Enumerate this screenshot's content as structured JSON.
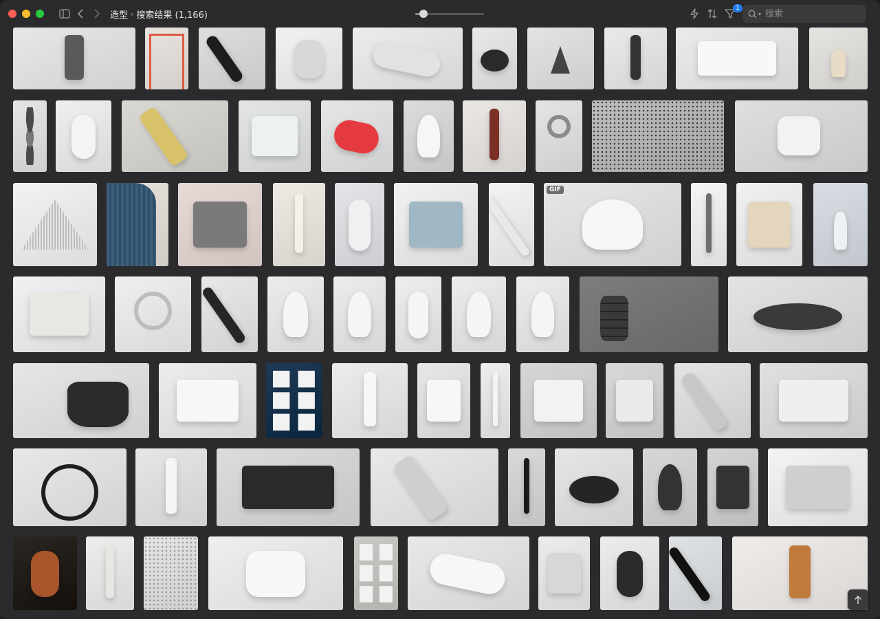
{
  "window": {
    "breadcrumb_parent": "造型",
    "breadcrumb_current": "搜索结果 (1,166)"
  },
  "toolbar": {
    "filter_badge": "1",
    "search_placeholder": "搜索",
    "zoom_level": 0.12
  },
  "icons": [
    "sidebar-icon",
    "back-icon",
    "forward-icon",
    "bolt-icon",
    "sort-icon",
    "filter-icon",
    "search-icon",
    "arrow-up-icon"
  ],
  "thumbnails": [
    {
      "bg": "#e7e7e7",
      "shape": "tall",
      "obj": "#5a5a5a"
    },
    {
      "bg": "#e9e4df",
      "shape": "shelf",
      "obj": "#e05a43"
    },
    {
      "bg": "#dedede",
      "shape": "diag",
      "obj": "#1d1d1f"
    },
    {
      "bg": "#f2f2f2",
      "shape": "round",
      "obj": "#d8d8d8"
    },
    {
      "bg": "#ececec",
      "shape": "pill",
      "obj": "#e2e2e2"
    },
    {
      "bg": "#e8e8e8",
      "shape": "disk",
      "obj": "#2a2a2a"
    },
    {
      "bg": "#e3e3e3",
      "shape": "cone",
      "obj": "#444"
    },
    {
      "bg": "#eaeaea",
      "shape": "tall",
      "obj": "#333"
    },
    {
      "bg": "#ebebeb",
      "shape": "box",
      "obj": "#f8f8f8"
    },
    {
      "bg": "#e6e4e1",
      "shape": "vase",
      "obj": "#e9dcc6"
    },
    {
      "bg": "#e5e5e5",
      "shape": "stones",
      "obj": "#4a4a4a"
    },
    {
      "bg": "#efefef",
      "shape": "round",
      "obj": "#f4f4f4"
    },
    {
      "bg": "#d9d8d3",
      "shape": "diag",
      "obj": "#d9c36a"
    },
    {
      "bg": "#e4e6e6",
      "shape": "box",
      "obj": "#eef1f1"
    },
    {
      "bg": "#e6e6e6",
      "shape": "pill",
      "obj": "#e53a40"
    },
    {
      "bg": "#dcdcdc",
      "shape": "dome",
      "obj": "#f6f6f6"
    },
    {
      "bg": "#ebe7e4",
      "shape": "tall",
      "obj": "#7a3024"
    },
    {
      "bg": "#e4e4e4",
      "shape": "ring",
      "obj": "#8a8a8a"
    },
    {
      "bg": "#bdbdbd",
      "shape": "dots",
      "obj": "#222"
    },
    {
      "bg": "#dfdfdf",
      "shape": "cube",
      "obj": "#f2f2f2"
    },
    {
      "bg": "#f2f2f2",
      "shape": "tent",
      "obj": "#bdbdbd"
    },
    {
      "bg": "#e8e2dc",
      "shape": "barrel",
      "obj": "#3c5f7d"
    },
    {
      "bg": "#e7dad6",
      "shape": "box",
      "obj": "#7a7a7a"
    },
    {
      "bg": "#eee9e3",
      "shape": "tall",
      "obj": "#f4f0ea"
    },
    {
      "bg": "#e2e4e8",
      "shape": "round",
      "obj": "#f0f0f0"
    },
    {
      "bg": "#f1f1f1",
      "shape": "box",
      "obj": "#9fb8c4"
    },
    {
      "bg": "#f3f3f3",
      "shape": "diag",
      "obj": "#e9e9e9"
    },
    {
      "bg": "#e7e6e7",
      "shape": "dome",
      "obj": "#f6f6f6",
      "gif": "GIF"
    },
    {
      "bg": "#f4f4f4",
      "shape": "tall",
      "obj": "#6e6e6e"
    },
    {
      "bg": "#f1f1f1",
      "shape": "box",
      "obj": "#e3d6bd"
    },
    {
      "bg": "#d8dde3",
      "shape": "vase",
      "obj": "#eef0f2"
    },
    {
      "bg": "#f1f1f1",
      "shape": "box",
      "obj": "#e8e8e3"
    },
    {
      "bg": "#efefef",
      "shape": "ring",
      "obj": "#bdbdbd"
    },
    {
      "bg": "#e8e8e8",
      "shape": "diag",
      "obj": "#262626"
    },
    {
      "bg": "#ececec",
      "shape": "dome",
      "obj": "#f5f5f5"
    },
    {
      "bg": "#ececec",
      "shape": "dome",
      "obj": "#f5f5f5"
    },
    {
      "bg": "#eeeeee",
      "shape": "round",
      "obj": "#f5f5f5"
    },
    {
      "bg": "#ececec",
      "shape": "dome",
      "obj": "#f5f5f5"
    },
    {
      "bg": "#ececec",
      "shape": "dome",
      "obj": "#f5f5f5"
    },
    {
      "bg": "#7d7d7d",
      "shape": "stack",
      "obj": "#3a3a3a"
    },
    {
      "bg": "#e3e3e3",
      "shape": "disk",
      "obj": "#3a3a3a"
    },
    {
      "bg": "#e6e6e6",
      "shape": "pot",
      "obj": "#2b2b2b"
    },
    {
      "bg": "#ececec",
      "shape": "box",
      "obj": "#f7f7f7"
    },
    {
      "bg": "#1f3a55",
      "shape": "grid",
      "obj": "#f2f2f2"
    },
    {
      "bg": "#ececec",
      "shape": "tall",
      "obj": "#f7f7f7"
    },
    {
      "bg": "#e7e7e7",
      "shape": "box",
      "obj": "#f7f7f7"
    },
    {
      "bg": "#ededed",
      "shape": "tall",
      "obj": "#f4f4f4"
    },
    {
      "bg": "#d7d7d7",
      "shape": "box",
      "obj": "#f2f2f2"
    },
    {
      "bg": "#d8d8d8",
      "shape": "box",
      "obj": "#eaeaea"
    },
    {
      "bg": "#e3e3e3",
      "shape": "diag",
      "obj": "#c8c8c8"
    },
    {
      "bg": "#e0e0e0",
      "shape": "box",
      "obj": "#efefef"
    },
    {
      "bg": "#e8e8e8",
      "shape": "ring",
      "obj": "#1e1e1e"
    },
    {
      "bg": "#e6e6e6",
      "shape": "tall",
      "obj": "#f5f5f5"
    },
    {
      "bg": "#dcdcdc",
      "shape": "box",
      "obj": "#2a2a2a"
    },
    {
      "bg": "#e9e9e9",
      "shape": "diag",
      "obj": "#cfcfcf"
    },
    {
      "bg": "#d9d9d9",
      "shape": "tall",
      "obj": "#1a1a1a"
    },
    {
      "bg": "#e6e6e6",
      "shape": "disk",
      "obj": "#252525"
    },
    {
      "bg": "#d7d7d7",
      "shape": "dome",
      "obj": "#333"
    },
    {
      "bg": "#d4d4d4",
      "shape": "box",
      "obj": "#333"
    },
    {
      "bg": "#f3f3f3",
      "shape": "box",
      "obj": "#cfcfcf"
    },
    {
      "bg": "#2b2622",
      "shape": "round",
      "obj": "#a8552b"
    },
    {
      "bg": "#ededed",
      "shape": "tall",
      "obj": "#e8e6e2"
    },
    {
      "bg": "#e5e5e5",
      "shape": "dots",
      "obj": "#8c8c8c"
    },
    {
      "bg": "#efefef",
      "shape": "round",
      "obj": "#f7f7f7"
    },
    {
      "bg": "#c7c9c4",
      "shape": "grid",
      "obj": "#f2f2f2"
    },
    {
      "bg": "#e9e9e9",
      "shape": "pill",
      "obj": "#f7f7f7"
    },
    {
      "bg": "#ececec",
      "shape": "box",
      "obj": "#d7d7d7"
    },
    {
      "bg": "#ececec",
      "shape": "round",
      "obj": "#2a2a2a"
    },
    {
      "bg": "#dfe2e4",
      "shape": "diag",
      "obj": "#111"
    },
    {
      "bg": "#efecea",
      "shape": "tall",
      "obj": "#c07a3c"
    }
  ]
}
